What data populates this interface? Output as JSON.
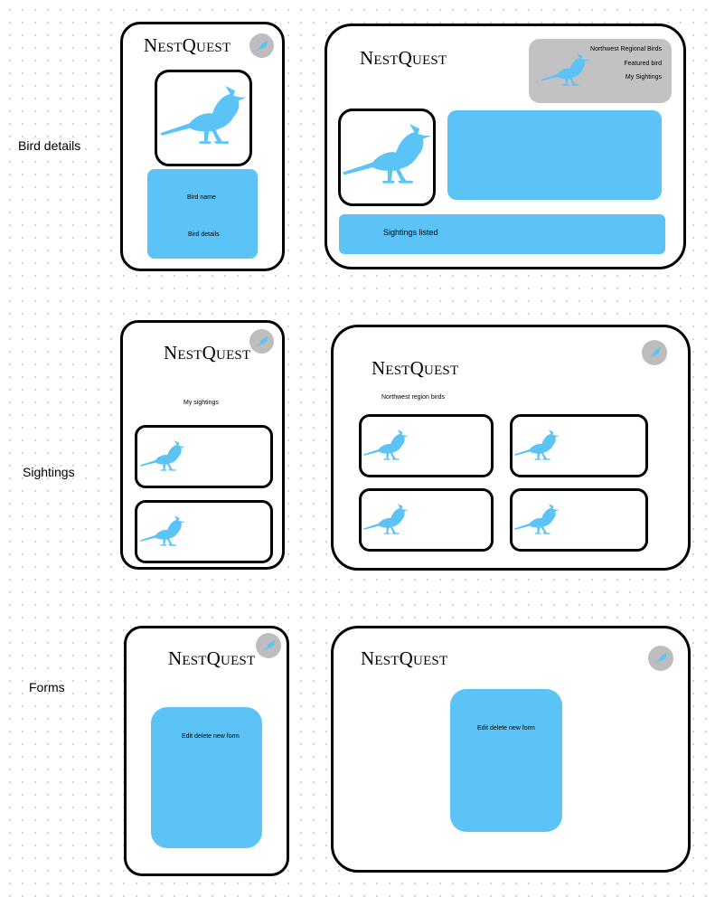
{
  "row_labels": {
    "bird_details": "Bird details",
    "sightings": "Sightings",
    "forms": "Forms"
  },
  "logo": {
    "first_letter": "N",
    "first_rest": "EST",
    "second_letter": "Q",
    "second_rest": "UEST"
  },
  "colors": {
    "accent_blue": "#5bc3f5",
    "avatar_gray": "#bdbdbd",
    "menu_gray": "#c2c2c2",
    "border": "#000000"
  },
  "icons": {
    "avatar": "bird-icon",
    "bird_image": "blue-jay-silhouette"
  },
  "bird_details_mobile": {
    "bird_name": "Bird name",
    "bird_details": "Bird details"
  },
  "bird_details_desktop": {
    "menu": [
      "Northwest Regional Birds",
      "Featured bird",
      "My Sightings"
    ],
    "sightings_listed": "Sightings listed"
  },
  "sightings_mobile": {
    "title": "My sightings",
    "card_count": 2
  },
  "sightings_desktop": {
    "title": "Northwest region birds",
    "card_count": 4
  },
  "forms_mobile": {
    "form_label": "Edit delete new form"
  },
  "forms_desktop": {
    "form_label": "Edit delete new form"
  }
}
